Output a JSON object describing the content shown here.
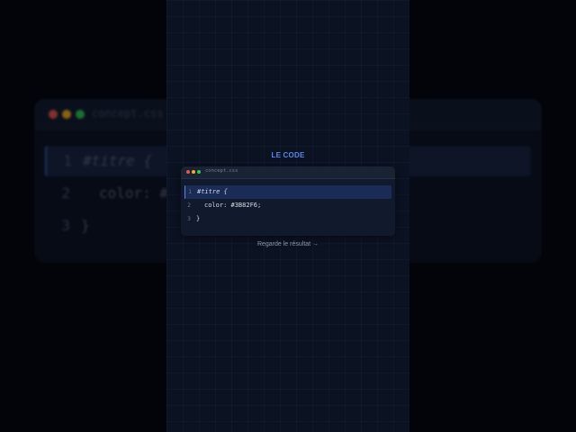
{
  "background_editor": {
    "filename": "concept.css",
    "lines": [
      {
        "number": "1",
        "text": "#titre {"
      },
      {
        "number": "2",
        "text": "color: #"
      },
      {
        "number": "3",
        "text": "}"
      }
    ]
  },
  "panel": {
    "section_title": "LE CODE",
    "editor": {
      "filename": "concept.css",
      "window_dots": [
        "#ef5350",
        "#f5b021",
        "#34c759"
      ],
      "lines": [
        {
          "number": "1",
          "text": "#titre {"
        },
        {
          "number": "2",
          "text": "color: #3B82F6;"
        },
        {
          "number": "3",
          "text": "}"
        }
      ]
    },
    "cta_label": "Regarde le résultat →"
  },
  "colors": {
    "accent": "#5b86f0",
    "panel_background": "#0b1222",
    "page_background": "#020409"
  }
}
